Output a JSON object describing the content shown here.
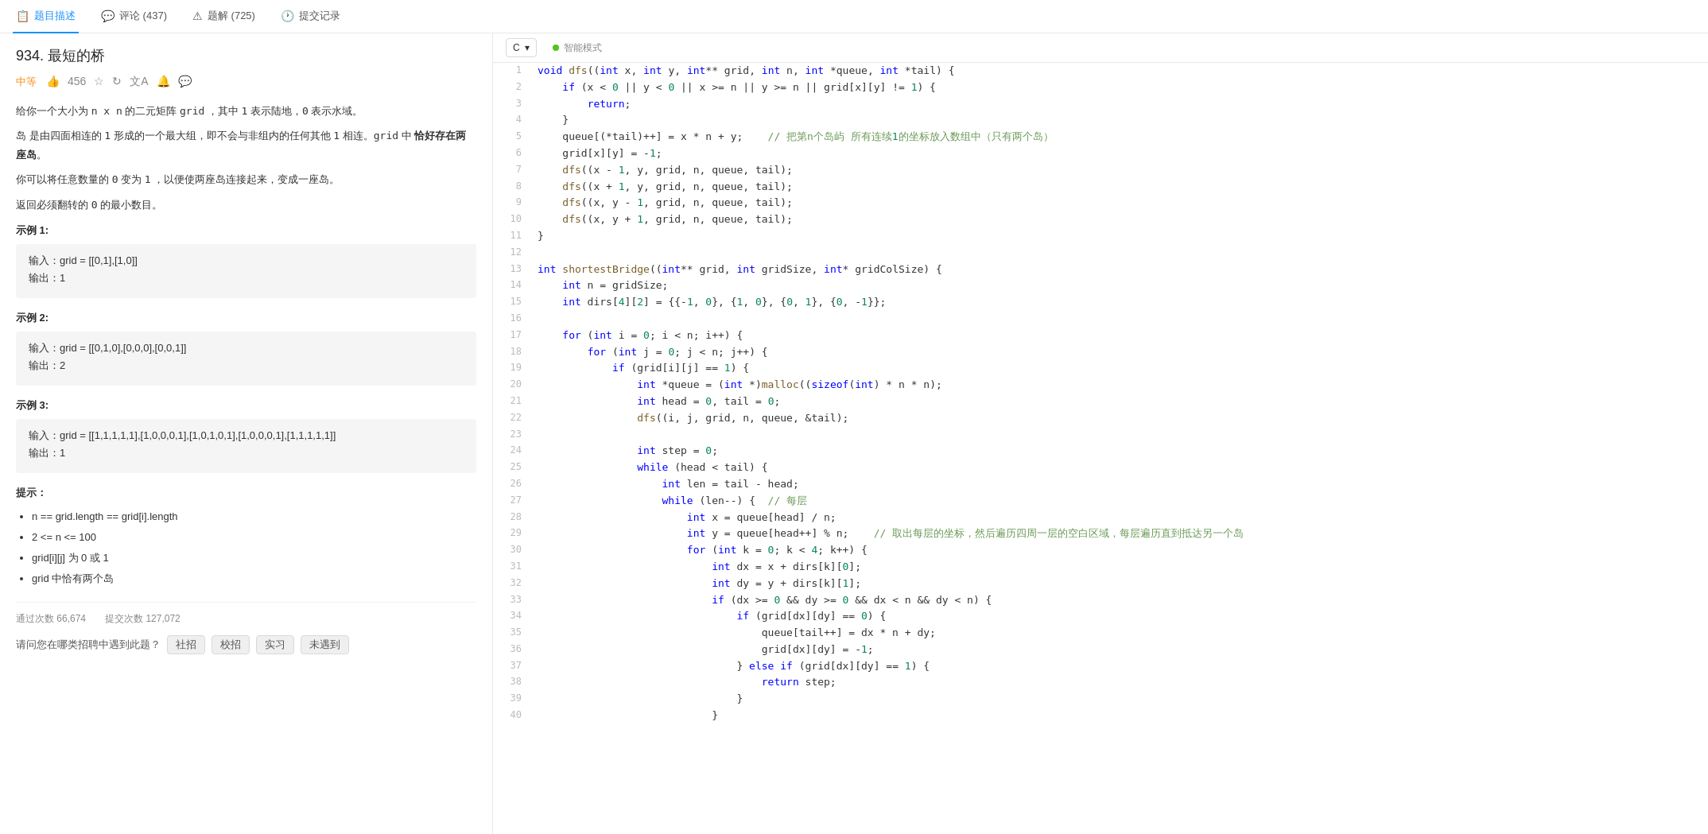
{
  "nav": {
    "items": [
      {
        "id": "description",
        "icon": "📋",
        "label": "题目描述",
        "active": true
      },
      {
        "id": "comments",
        "icon": "💬",
        "label": "评论 (437)",
        "active": false
      },
      {
        "id": "solutions",
        "icon": "⚠",
        "label": "题解 (725)",
        "active": false
      },
      {
        "id": "submissions",
        "icon": "🕐",
        "label": "提交记录",
        "active": false
      }
    ]
  },
  "problem": {
    "title": "934. 最短的桥",
    "difficulty": "中等",
    "likes": 456,
    "description_lines": [
      "给你一个大小为 n x n 的二元矩阵 grid ，其中 1 表示陆地，0 表示水域。",
      "岛 是由四面相连的 1 形成的一个最大组，即不会与非组内的任何其他 1 相连。grid 中 恰好存在两座岛。",
      "你可以将任意数量的 0 变为 1 ，以便使两座岛连接起来，变成一座岛。",
      "返回必须翻转的 0 的最小数目。"
    ],
    "examples": [
      {
        "title": "示例 1:",
        "input": "输入：grid = [[0,1],[1,0]]",
        "output": "输出：1"
      },
      {
        "title": "示例 2:",
        "input": "输入：grid = [[0,1,0],[0,0,0],[0,0,1]]",
        "output": "输出：2"
      },
      {
        "title": "示例 3:",
        "input": "输入：grid = [[1,1,1,1,1],[1,0,0,0,1],[1,0,1,0,1],[1,0,0,0,1],[1,1,1,1,1]]",
        "output": "输出：1"
      }
    ],
    "hints_title": "提示：",
    "hints": [
      "n == grid.length == grid[i].length",
      "2 <= n <= 100",
      "grid[i][j] 为 0 或 1",
      "grid 中恰有两个岛"
    ],
    "stats": {
      "pass_count_label": "通过次数",
      "pass_count": "66,674",
      "submit_count_label": "提交次数",
      "submit_count": "127,072"
    },
    "tags_label": "请问您在哪类招聘中遇到此题？",
    "tags": [
      "社招",
      "校招",
      "实习",
      "未遇到"
    ]
  },
  "editor": {
    "language": "C",
    "smart_mode_label": "智能模式",
    "code_lines": [
      {
        "num": 1,
        "content": "void dfs(int x, int y, int** grid, int n, int *queue, int *tail) {"
      },
      {
        "num": 2,
        "content": "    if (x < 0 || y < 0 || x >= n || y >= n || grid[x][y] != 1) {"
      },
      {
        "num": 3,
        "content": "        return;"
      },
      {
        "num": 4,
        "content": "    }"
      },
      {
        "num": 5,
        "content": "    queue[(*tail)++] = x * n + y;    // 把第n个岛屿 所有连续1的坐标放入数组中（只有两个岛）"
      },
      {
        "num": 6,
        "content": "    grid[x][y] = -1;"
      },
      {
        "num": 7,
        "content": "    dfs(x - 1, y, grid, n, queue, tail);"
      },
      {
        "num": 8,
        "content": "    dfs(x + 1, y, grid, n, queue, tail);"
      },
      {
        "num": 9,
        "content": "    dfs(x, y - 1, grid, n, queue, tail);"
      },
      {
        "num": 10,
        "content": "    dfs(x, y + 1, grid, n, queue, tail);"
      },
      {
        "num": 11,
        "content": "}"
      },
      {
        "num": 12,
        "content": ""
      },
      {
        "num": 13,
        "content": "int shortestBridge(int** grid, int gridSize, int* gridColSize) {"
      },
      {
        "num": 14,
        "content": "    int n = gridSize;"
      },
      {
        "num": 15,
        "content": "    int dirs[4][2] = {{-1, 0}, {1, 0}, {0, 1}, {0, -1}};"
      },
      {
        "num": 16,
        "content": ""
      },
      {
        "num": 17,
        "content": "    for (int i = 0; i < n; i++) {"
      },
      {
        "num": 18,
        "content": "        for (int j = 0; j < n; j++) {"
      },
      {
        "num": 19,
        "content": "            if (grid[i][j] == 1) {"
      },
      {
        "num": 20,
        "content": "                int *queue = (int *)malloc(sizeof(int) * n * n);"
      },
      {
        "num": 21,
        "content": "                int head = 0, tail = 0;"
      },
      {
        "num": 22,
        "content": "                dfs(i, j, grid, n, queue, &tail);"
      },
      {
        "num": 23,
        "content": ""
      },
      {
        "num": 24,
        "content": "                int step = 0;"
      },
      {
        "num": 25,
        "content": "                while (head < tail) {"
      },
      {
        "num": 26,
        "content": "                    int len = tail - head;"
      },
      {
        "num": 27,
        "content": "                    while (len--) {  // 每层"
      },
      {
        "num": 28,
        "content": "                        int x = queue[head] / n;"
      },
      {
        "num": 29,
        "content": "                        int y = queue[head++] % n;    // 取出每层的坐标，然后遍历四周一层的空白区域，每层遍历直到抵达另一个岛"
      },
      {
        "num": 30,
        "content": "                        for (int k = 0; k < 4; k++) {"
      },
      {
        "num": 31,
        "content": "                            int dx = x + dirs[k][0];"
      },
      {
        "num": 32,
        "content": "                            int dy = y + dirs[k][1];"
      },
      {
        "num": 33,
        "content": "                            if (dx >= 0 && dy >= 0 && dx < n && dy < n) {"
      },
      {
        "num": 34,
        "content": "                                if (grid[dx][dy] == 0) {"
      },
      {
        "num": 35,
        "content": "                                    queue[tail++] = dx * n + dy;"
      },
      {
        "num": 36,
        "content": "                                    grid[dx][dy] = -1;"
      },
      {
        "num": 37,
        "content": "                                } else if (grid[dx][dy] == 1) {"
      },
      {
        "num": 38,
        "content": "                                    return step;"
      },
      {
        "num": 39,
        "content": "                                }"
      },
      {
        "num": 40,
        "content": "                            }"
      }
    ]
  }
}
